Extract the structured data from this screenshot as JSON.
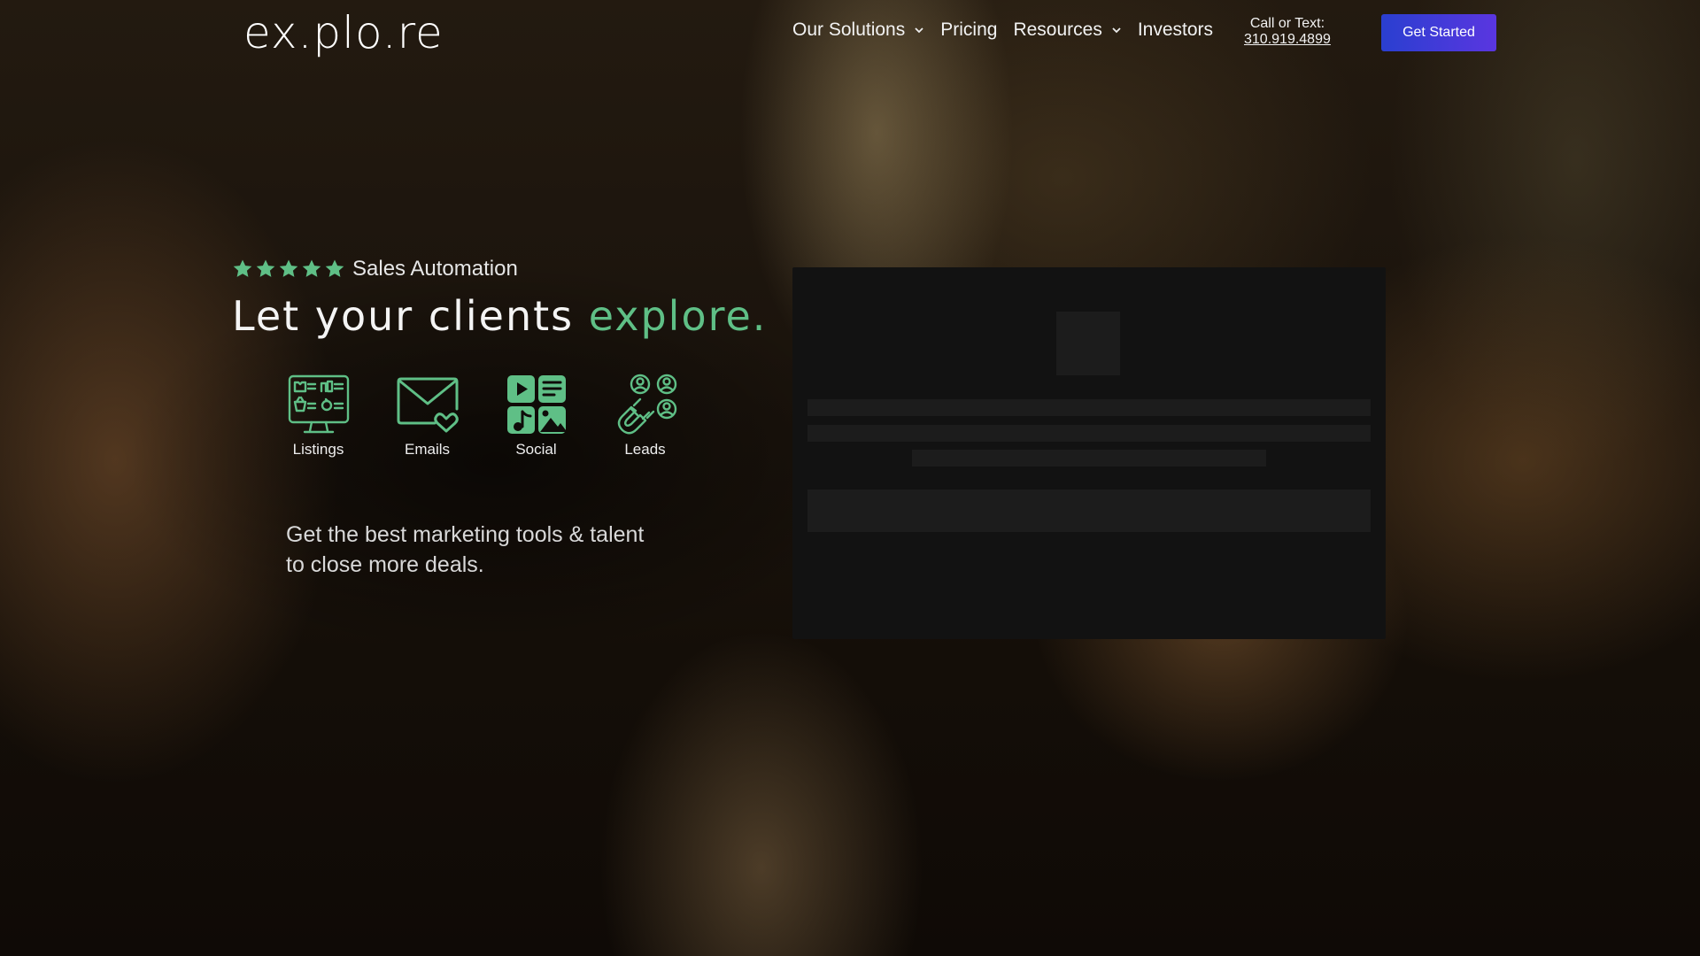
{
  "header": {
    "logo": "ex.plo.re",
    "nav": [
      {
        "label": "Our Solutions",
        "has_dropdown": true
      },
      {
        "label": "Pricing",
        "has_dropdown": false
      },
      {
        "label": "Resources",
        "has_dropdown": true
      },
      {
        "label": "Investors",
        "has_dropdown": false
      }
    ],
    "call_label": "Call or Text:",
    "call_phone": "310.919.4899",
    "cta_label": "Get Started"
  },
  "hero": {
    "rating_stars": 5,
    "tagline": "Sales Automation",
    "headline_main": "Let your clients ",
    "headline_accent": "explore.",
    "features": [
      {
        "label": "Listings",
        "icon": "listings-monitor-icon"
      },
      {
        "label": "Emails",
        "icon": "email-heart-icon"
      },
      {
        "label": "Social",
        "icon": "social-media-grid-icon"
      },
      {
        "label": "Leads",
        "icon": "lead-magnet-icon"
      }
    ],
    "subcopy": "Get the best marketing tools & talent to close more deals."
  },
  "colors": {
    "accent_green": "#5fbf86",
    "cta_gradient_start": "#2a3fd0",
    "cta_gradient_end": "#5a36e0",
    "panel_bg": "#121212"
  }
}
